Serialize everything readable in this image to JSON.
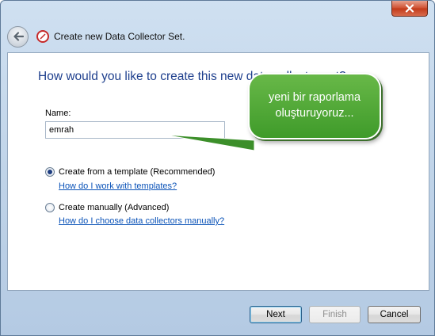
{
  "window": {
    "title": "Create new Data Collector Set."
  },
  "main": {
    "heading": "How would you like to create this new data collector set?",
    "name_label": "Name:",
    "name_value": "emrah",
    "options": [
      {
        "label": "Create from a template (Recommended)",
        "selected": true,
        "help": "How do I work with templates?"
      },
      {
        "label": "Create manually (Advanced)",
        "selected": false,
        "help": "How do I choose data collectors manually?"
      }
    ]
  },
  "annotation": {
    "line1": "yeni bir raporlama",
    "line2": "oluşturuyoruz..."
  },
  "buttons": {
    "next": "Next",
    "finish": "Finish",
    "cancel": "Cancel"
  },
  "colors": {
    "heading": "#1e3f8d",
    "link": "#0b53b8",
    "callout": "#4ea836",
    "close": "#c7401e"
  }
}
